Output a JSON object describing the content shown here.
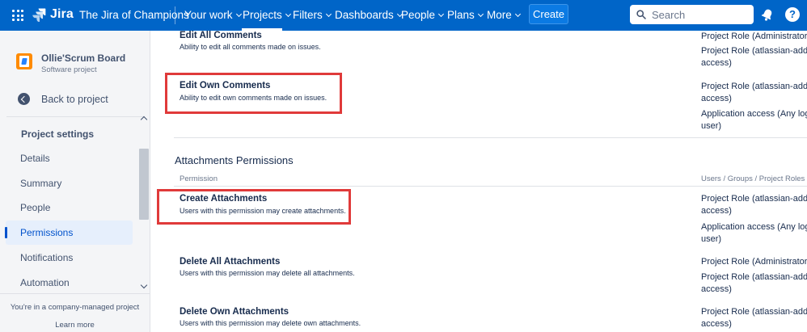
{
  "topbar": {
    "logo_text": "Jira",
    "site_name": "The Jira of Champions",
    "nav": [
      "Your work",
      "Projects",
      "Filters",
      "Dashboards",
      "People",
      "Plans",
      "More"
    ],
    "create_label": "Create",
    "search_placeholder": "Search",
    "help_glyph": "?",
    "colors": {
      "bar": "#0065c8",
      "create": "#0b7ae3"
    }
  },
  "sidebar": {
    "project_name": "Ollie'Scrum Board",
    "project_type": "Software project",
    "back_label": "Back to project",
    "section_title": "Project settings",
    "items": [
      "Details",
      "Summary",
      "People",
      "Permissions",
      "Notifications",
      "Automation"
    ],
    "active_item": "Permissions",
    "footer_text": "You're in a company-managed project",
    "footer_link": "Learn more"
  },
  "main": {
    "comments": [
      {
        "title": "Edit All Comments",
        "desc": "Ability to edit all comments made on issues.",
        "grants": [
          "Project Role (Administrators",
          "Project Role (atlassian-addo",
          "access)"
        ]
      },
      {
        "title": "Edit Own Comments",
        "desc": "Ability to edit own comments made on issues.",
        "grants": [
          "Project Role (atlassian-addo",
          "access)",
          "Application access (Any log",
          "user)"
        ]
      }
    ],
    "attachments_section": {
      "title": "Attachments Permissions",
      "col_permission": "Permission",
      "col_grants": "Users / Groups / Project Roles",
      "rows": [
        {
          "title": "Create Attachments",
          "desc": "Users with this permission may create attachments.",
          "grants": [
            "Project Role (atlassian-addo",
            "access)",
            "Application access (Any log",
            "user)"
          ]
        },
        {
          "title": "Delete All Attachments",
          "desc": "Users with this permission may delete all attachments.",
          "grants": [
            "Project Role (Administrators",
            "Project Role (atlassian-addo",
            "access)"
          ]
        },
        {
          "title": "Delete Own Attachments",
          "desc": "Users with this permission may delete own attachments.",
          "grants": [
            "Project Role (atlassian-addo",
            "access)"
          ]
        }
      ]
    },
    "highlight_color": "#e03a3a"
  }
}
